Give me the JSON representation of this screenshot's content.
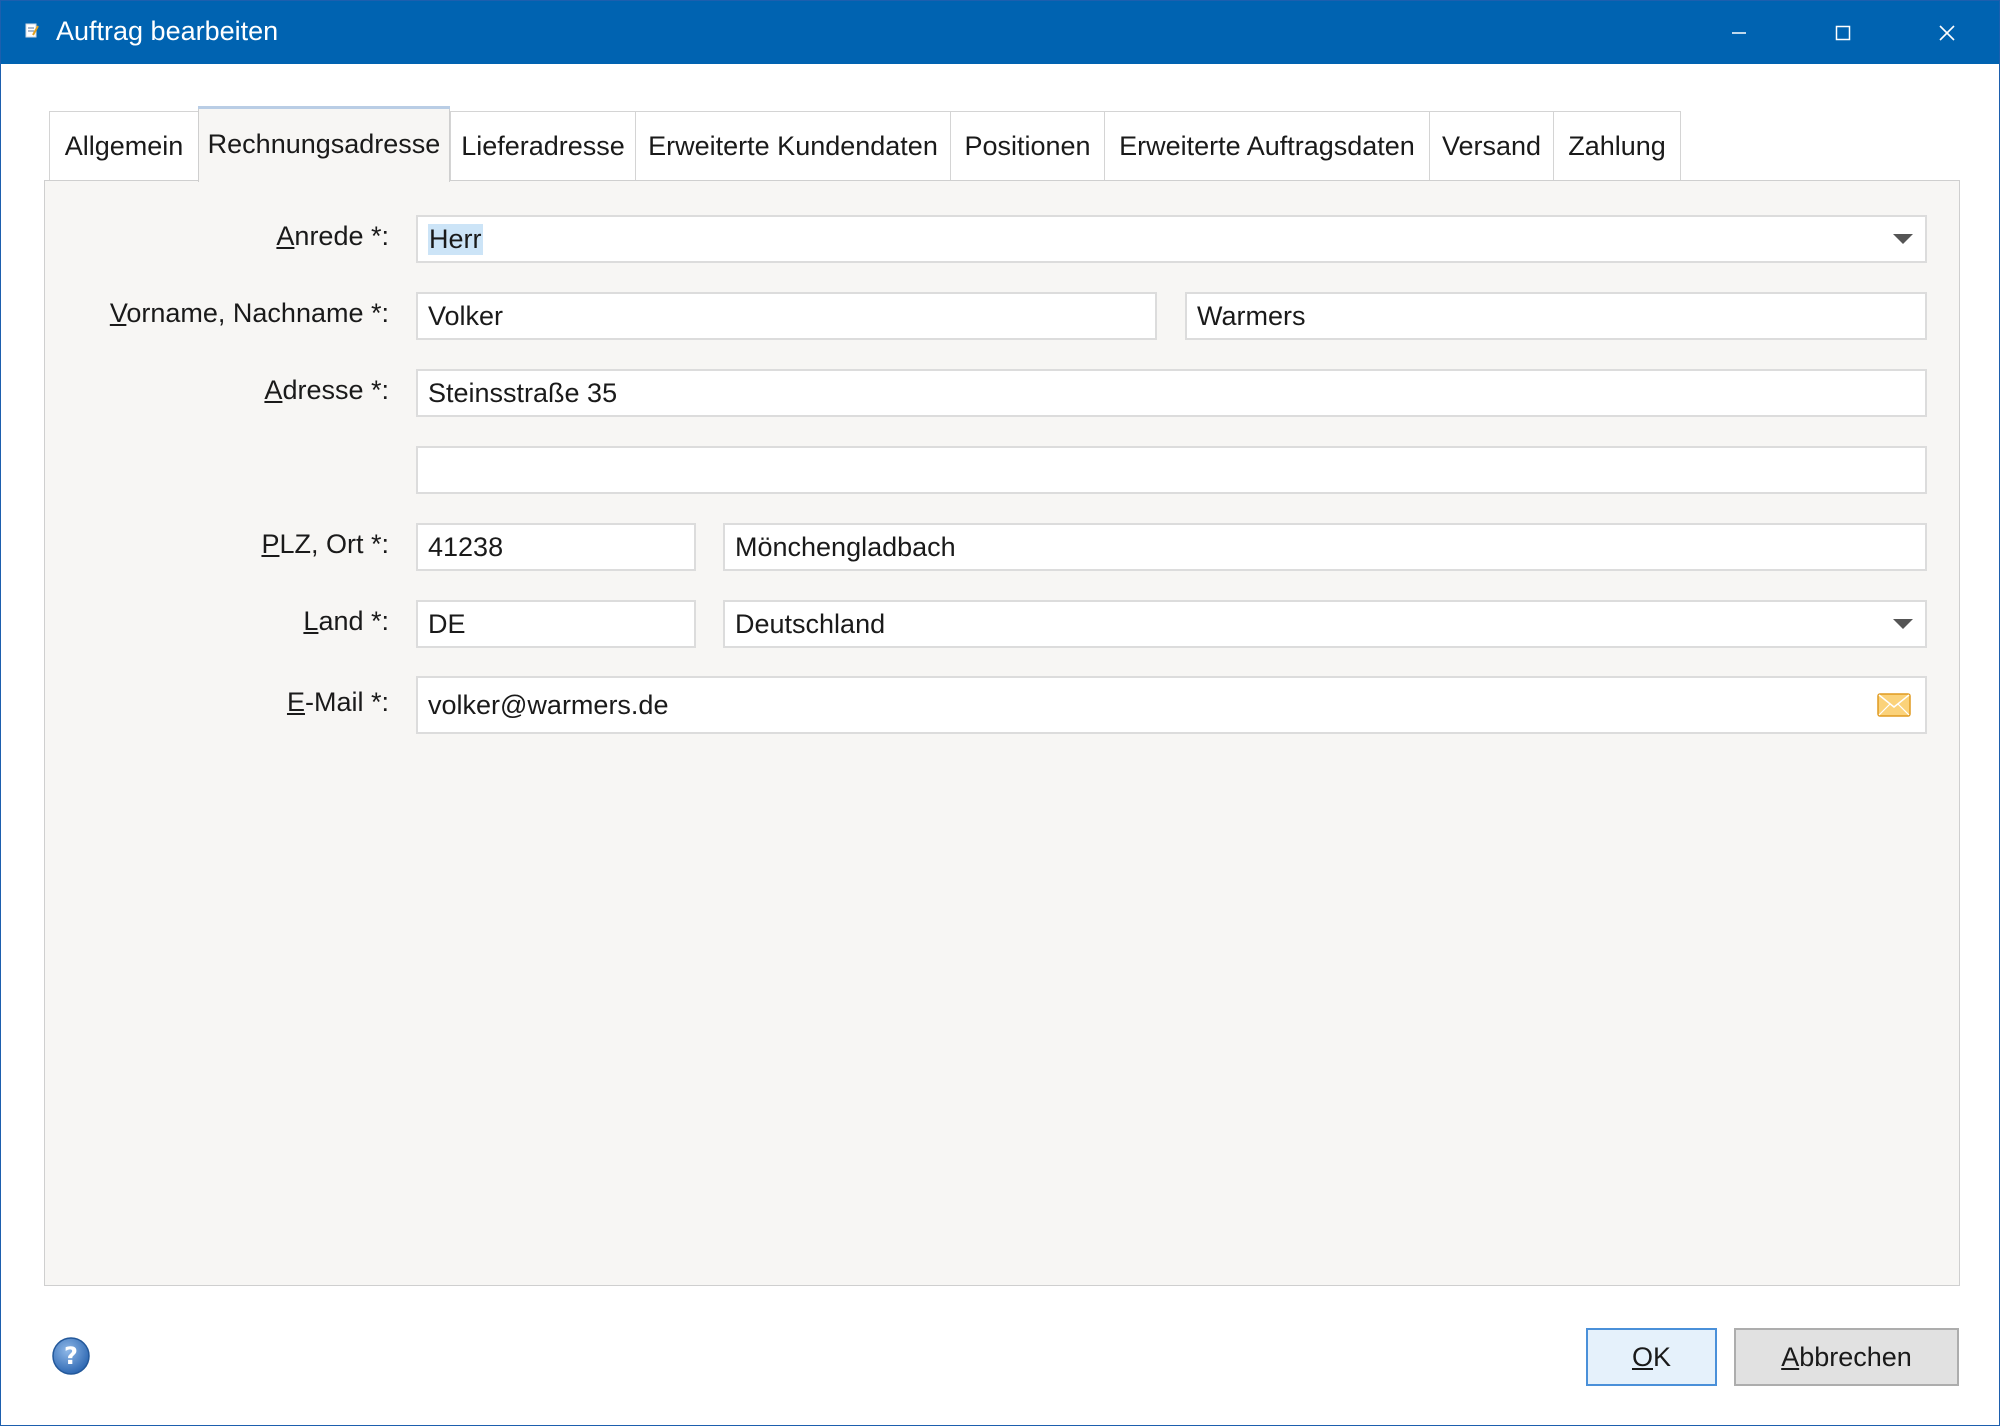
{
  "window": {
    "title": "Auftrag bearbeiten",
    "controls": {
      "minimize": "minimize",
      "maximize": "maximize",
      "close": "close"
    }
  },
  "tabs": [
    {
      "label": "Allgemein",
      "active": false
    },
    {
      "label": "Rechnungsadresse",
      "active": true
    },
    {
      "label": "Lieferadresse",
      "active": false
    },
    {
      "label": "Erweiterte Kundendaten",
      "active": false
    },
    {
      "label": "Positionen",
      "active": false
    },
    {
      "label": "Erweiterte Auftragsdaten",
      "active": false
    },
    {
      "label": "Versand",
      "active": false
    },
    {
      "label": "Zahlung",
      "active": false
    }
  ],
  "form": {
    "anrede": {
      "label_mnemonic": "A",
      "label_rest": "nrede *:",
      "value": "Herr"
    },
    "name": {
      "label_mnemonic": "V",
      "label_rest": "orname, Nachname *:",
      "first": "Volker",
      "last": "Warmers"
    },
    "adresse": {
      "label_mnemonic": "A",
      "label_rest": "dresse *:",
      "line1": "Steinsstraße 35",
      "line2": ""
    },
    "plz_ort": {
      "label_mnemonic": "P",
      "label_rest": "LZ, Ort *:",
      "plz": "41238",
      "ort": "Mönchengladbach"
    },
    "land": {
      "label_mnemonic": "L",
      "label_rest": "and *:",
      "code": "DE",
      "name": "Deutschland"
    },
    "email": {
      "label_mnemonic": "E",
      "label_rest": "-Mail *:",
      "value": "volker@warmers.de"
    }
  },
  "footer": {
    "ok": {
      "mnemonic": "O",
      "rest": "K"
    },
    "cancel": {
      "mnemonic": "A",
      "rest": "bbrechen"
    }
  },
  "colors": {
    "titlebar": "#0063b1",
    "panel": "#f7f6f4",
    "selection": "#cce4f7",
    "default_button_border": "#4a90d9",
    "mail_icon": "#f0a830"
  },
  "icons": [
    "app-icon",
    "minimize-icon",
    "maximize-icon",
    "close-icon",
    "dropdown-arrow-icon",
    "mail-icon",
    "help-icon"
  ]
}
